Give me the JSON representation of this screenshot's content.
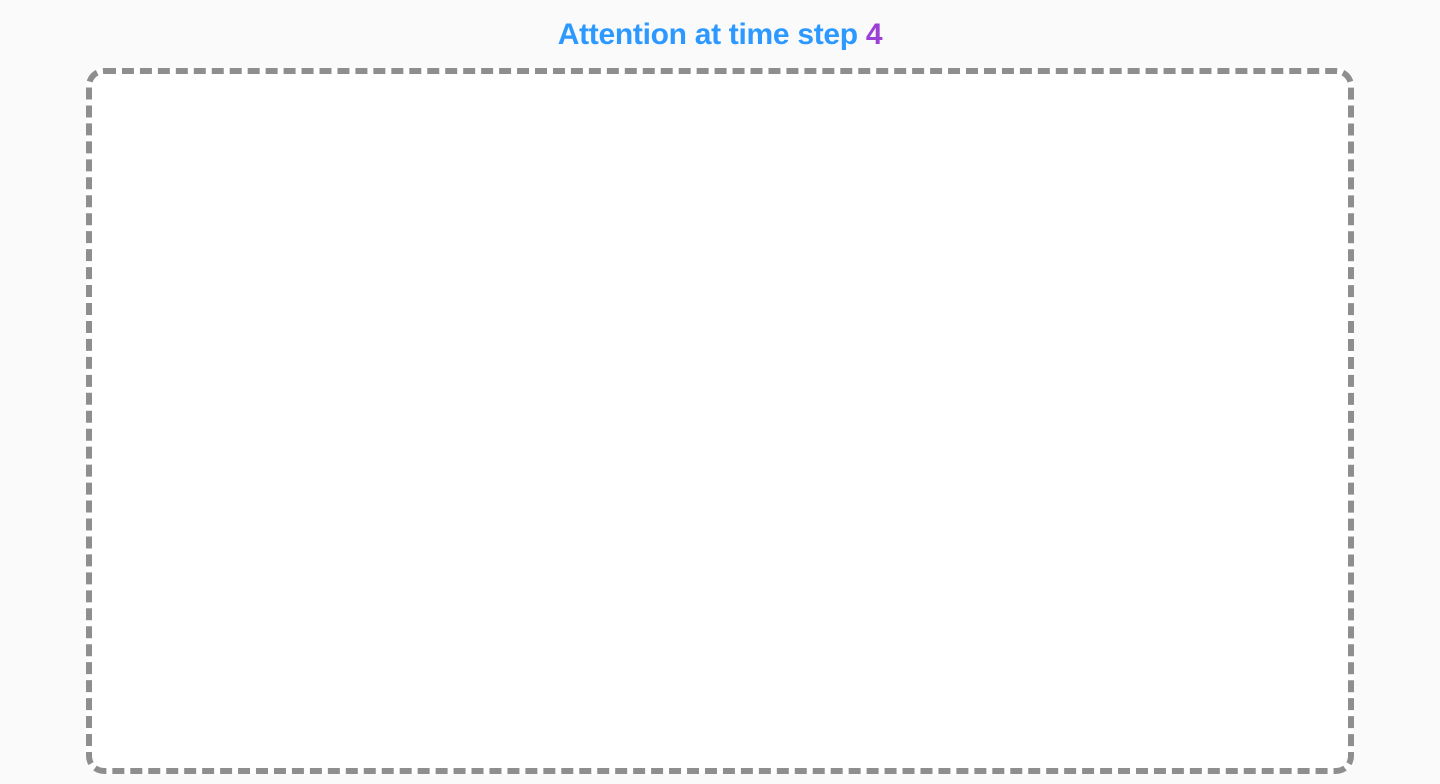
{
  "title": {
    "prefix": "Attention at time step ",
    "step": "4"
  },
  "colors": {
    "title_prefix": "#2b99ff",
    "title_step": "#9b3fd6",
    "border": "#8e8e8e",
    "page_bg": "#fafafa",
    "box_bg": "#ffffff"
  }
}
